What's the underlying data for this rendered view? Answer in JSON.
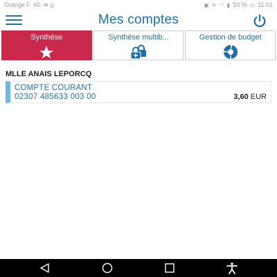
{
  "status_bar": {
    "carrier": "Orange F",
    "signal": "4G",
    "battery": "93 %",
    "time": "11:01"
  },
  "header": {
    "title": "Mes comptes",
    "menu_icon": "hamburger-icon",
    "power_icon": "power-icon"
  },
  "tiles": [
    {
      "label": "Synthèse",
      "icon": "star-icon",
      "active": true
    },
    {
      "label": "Synthèse multib...",
      "icon": "lock-icon",
      "active": false
    },
    {
      "label": "Gestion de budget",
      "icon": "donut-chart-icon",
      "active": false
    }
  ],
  "account_holder": "MLLE ANAIS LEPORCQ",
  "accounts": [
    {
      "type": "COMPTE COURANT",
      "number": "02307 485633 003 00",
      "balance": "3,60",
      "currency": "EUR"
    }
  ],
  "colors": {
    "primary": "#1f6ea8",
    "active_tile": "#c92a4b",
    "account_bar": "#6fb7de"
  }
}
